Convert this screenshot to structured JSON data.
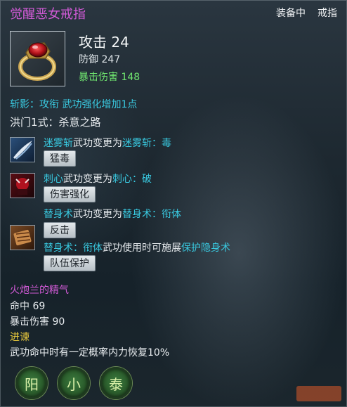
{
  "item": {
    "title": "觉醒恶女戒指",
    "header_equipped": "装备中",
    "header_slot": "戒指",
    "icon": "red-gem-ring-icon",
    "attack": "攻击 24",
    "defense": "防御 247",
    "crit_damage": "暴击伤害 148"
  },
  "skill_line": {
    "p1": "斩影：",
    "p2": "攻衔",
    "p3": " 武功强化增加1点"
  },
  "style_name": "洪门1式：杀意之路",
  "skills": [
    {
      "icon": "blue-slash-skill-icon",
      "r1_a": "迷雾斩",
      "r1_b": "武功变更为",
      "r1_c": "迷雾斩：毒",
      "button": "猛毒"
    },
    {
      "icon": "red-demon-skill-icon",
      "r1_a": "刺心",
      "r1_b": "武功变更为",
      "r1_c": "刺心：破",
      "button": "伤害强化"
    },
    {
      "icon": "brown-scroll-skill-icon",
      "r1_a": "替身术",
      "r1_b": "武功变更为",
      "r1_c": "替身术：衔体",
      "button1": "反击",
      "r2_a": "替身术：",
      "r2_b": "衔体",
      "r2_c": "武功使用时可施展",
      "r2_d": "保护隐身术",
      "button2": "队伍保护"
    }
  ],
  "bonus": {
    "title": "火炮兰的精气",
    "hit": "命中 69",
    "crit_damage": "暴击伤害 90",
    "progress_title": "进谏",
    "progress_desc": "武功命中时有一定概率内力恢复10%"
  },
  "gems": [
    {
      "glyph": "阳",
      "icon": "yang-gem-icon"
    },
    {
      "glyph": "小",
      "icon": "small-gem-icon"
    },
    {
      "glyph": "泰",
      "icon": "tai-gem-icon"
    }
  ],
  "colors": {
    "title": "#d35bd8",
    "stat_green": "#6fe46f",
    "skill_cyan": "#39c9e0",
    "bonus_yellow": "#e8c93c"
  }
}
